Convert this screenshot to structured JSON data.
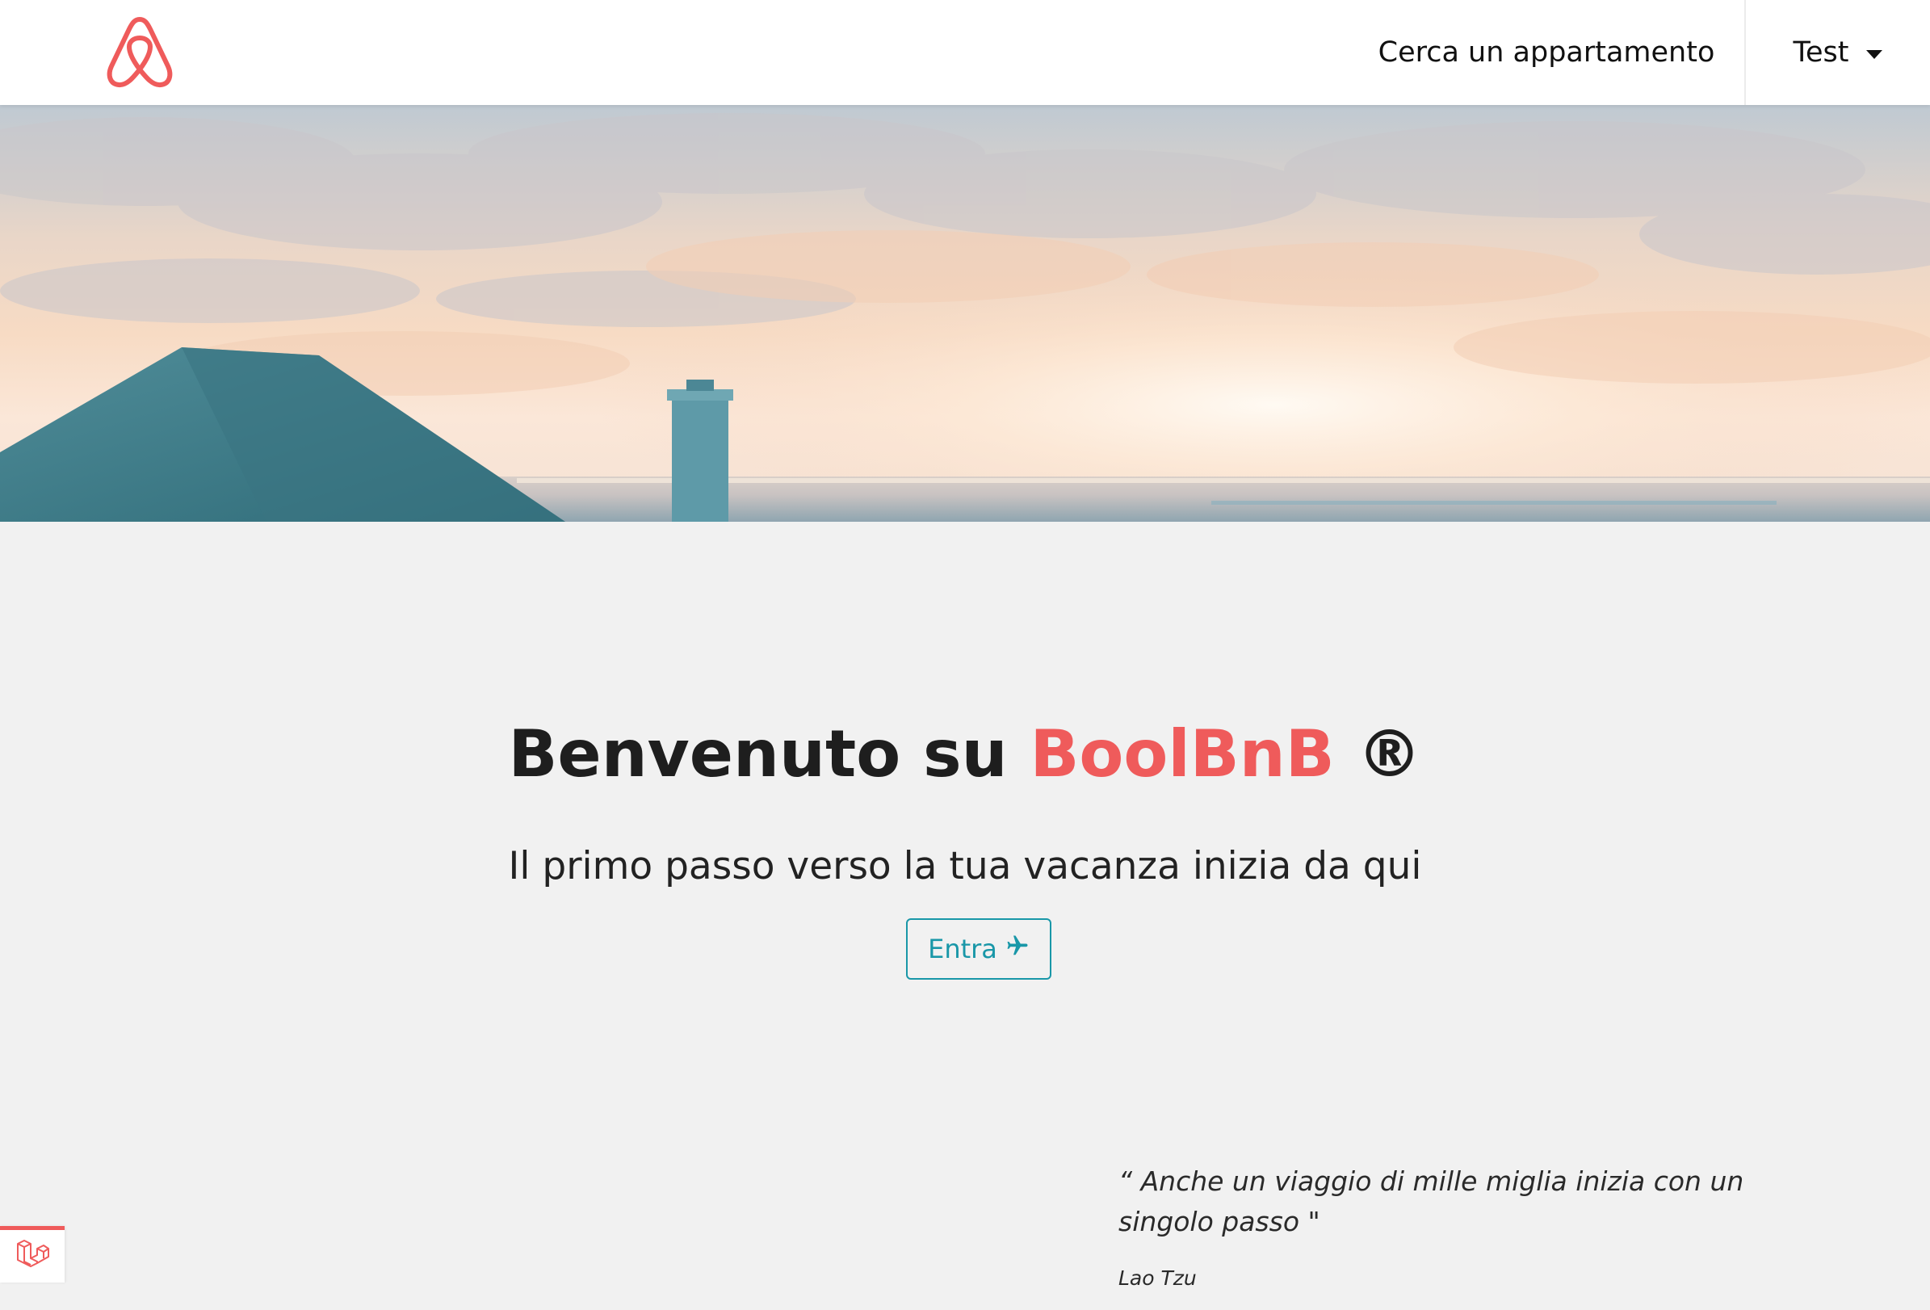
{
  "navbar": {
    "logo_icon": "airbnb-logo-icon",
    "search_link": "Cerca un appartamento",
    "user_menu": "Test",
    "user_menu_icon": "caret-down-icon"
  },
  "hero": {
    "image": "sunset-over-sea-with-roof-and-chimney"
  },
  "main": {
    "title_prefix": "Benvenuto su",
    "brand_name": "BoolBnB",
    "registered_mark": "®",
    "subtitle": "Il primo passo verso la tua vacanza inizia da qui",
    "enter_button": "Entra",
    "enter_button_icon": "plane-icon"
  },
  "quote": {
    "text": "“ Anche un viaggio di mille miglia inizia con un singolo passo \"",
    "author": "Lao Tzu"
  },
  "badge": {
    "icon": "laravel-icon"
  },
  "colors": {
    "brand": "#ef5b5b",
    "accent": "#1997a8",
    "background": "#f1f1f1"
  }
}
